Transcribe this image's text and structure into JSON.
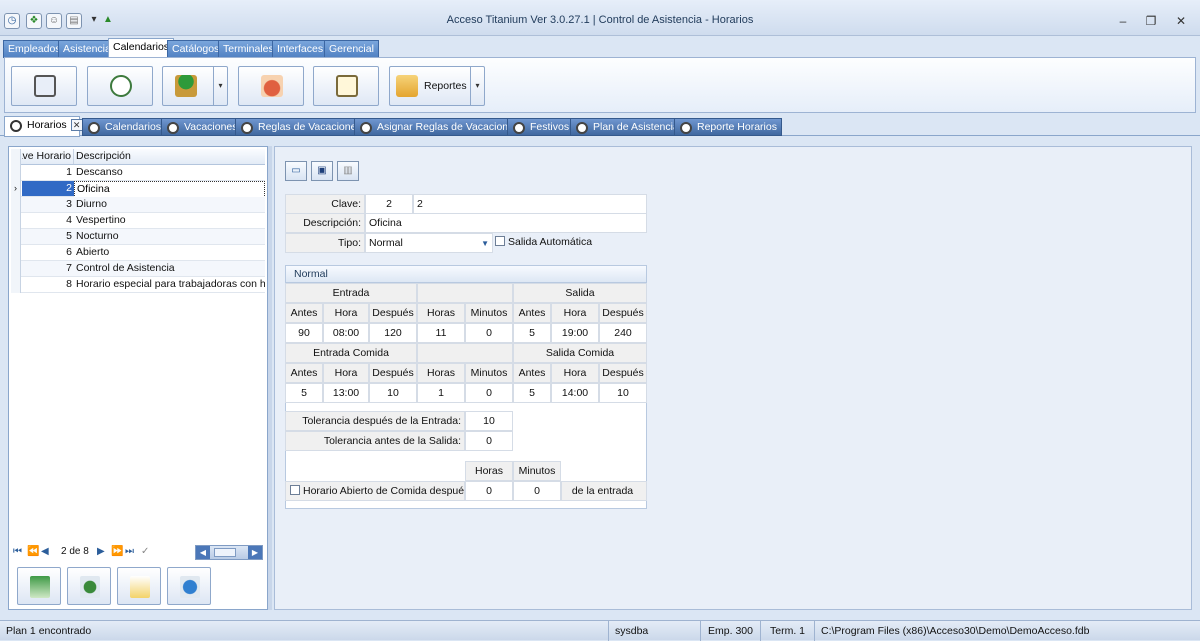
{
  "window": {
    "title": "Acceso Titanium  Ver 3.0.27.1 | Control de Asistencia - Horarios"
  },
  "menu_tabs": [
    "Empleados",
    "Asistencia",
    "Calendarios",
    "Catálogos",
    "Terminales",
    "Interfaces",
    "Gerencial"
  ],
  "ribbon": {
    "reportes_label": "Reportes"
  },
  "doc_tabs": [
    "Horarios",
    "Calendarios",
    "Vacaciones",
    "Reglas de Vacaciones",
    "Asignar Reglas de Vacaciones",
    "Festivos",
    "Plan de Asistencia",
    "Reporte Horarios"
  ],
  "grid": {
    "col_clave": "Clave Horario",
    "col_desc": "Descripción",
    "rows": [
      {
        "clave": "1",
        "desc": "Descanso"
      },
      {
        "clave": "2",
        "desc": "Oficina"
      },
      {
        "clave": "3",
        "desc": "Diurno"
      },
      {
        "clave": "4",
        "desc": "Vespertino"
      },
      {
        "clave": "5",
        "desc": "Nocturno"
      },
      {
        "clave": "6",
        "desc": "Abierto"
      },
      {
        "clave": "7",
        "desc": "Control de Asistencia"
      },
      {
        "clave": "8",
        "desc": "Horario especial para trabajadoras con hijos"
      }
    ],
    "selected_marker": "›",
    "pager": "2 de 8"
  },
  "form": {
    "clave_label": "Clave:",
    "clave_value": "2",
    "clave_value2": "2",
    "desc_label": "Descripción:",
    "desc_value": "Oficina",
    "tipo_label": "Tipo:",
    "tipo_value": "Normal",
    "salida_auto_label": "Salida Automática",
    "section_title": "Normal",
    "entrada": "Entrada",
    "salida": "Salida",
    "entrada_comida": "Entrada Comida",
    "salida_comida": "Salida Comida",
    "antes": "Antes",
    "hora": "Hora",
    "despues": "Después",
    "horas": "Horas",
    "minutos": "Minutos",
    "row1": {
      "e_antes": "90",
      "e_hora": "08:00",
      "e_despues": "120",
      "horas": "11",
      "minutos": "0",
      "s_antes": "5",
      "s_hora": "19:00",
      "s_despues": "240"
    },
    "row2": {
      "e_antes": "5",
      "e_hora": "13:00",
      "e_despues": "10",
      "horas": "1",
      "minutos": "0",
      "s_antes": "5",
      "s_hora": "14:00",
      "s_despues": "10"
    },
    "tol_entrada_label": "Tolerancia después de la Entrada:",
    "tol_entrada_value": "10",
    "tol_salida_label": "Tolerancia antes de la Salida:",
    "tol_salida_value": "0",
    "abierto_label": "Horario Abierto de Comida despué de",
    "abierto_horas": "0",
    "abierto_minutos": "0",
    "de_la_entrada": "de la entrada"
  },
  "status": {
    "message": "Plan 1 encontrado",
    "user": "sysdba",
    "emp": "Emp. 300",
    "term": "Term. 1",
    "path": "C:\\Program Files (x86)\\Acceso30\\Demo\\DemoAcceso.fdb"
  }
}
